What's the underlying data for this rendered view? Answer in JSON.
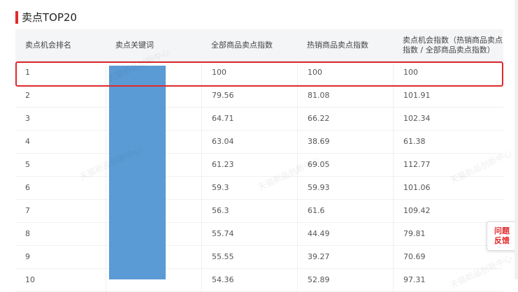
{
  "section": {
    "title": "卖点TOP20"
  },
  "table": {
    "headers": [
      "卖点机会排名",
      "卖点关键词",
      "全部商品卖点指数",
      "热销商品卖点指数",
      "卖点机会指数（热销商品卖点指数 / 全部商品卖点指数）"
    ],
    "rows": [
      [
        "1",
        "",
        "100",
        "100",
        "100"
      ],
      [
        "2",
        "",
        "79.56",
        "81.08",
        "101.91"
      ],
      [
        "3",
        "",
        "64.71",
        "66.22",
        "102.34"
      ],
      [
        "4",
        "",
        "63.04",
        "38.69",
        "61.38"
      ],
      [
        "5",
        "",
        "61.23",
        "69.05",
        "112.77"
      ],
      [
        "6",
        "",
        "59.3",
        "59.93",
        "101.06"
      ],
      [
        "7",
        "",
        "56.3",
        "61.6",
        "109.42"
      ],
      [
        "8",
        "",
        "55.74",
        "44.49",
        "79.81"
      ],
      [
        "9",
        "",
        "55.55",
        "39.27",
        "70.69"
      ],
      [
        "10",
        "",
        "54.36",
        "52.89",
        "97.31"
      ]
    ]
  },
  "feedback": {
    "line1": "问题",
    "line2": "反馈"
  },
  "watermark": {
    "text": "天猫新品创新中心"
  },
  "colors": {
    "accent": "#e0282b",
    "keyword_mask": "#5b9bd5"
  }
}
